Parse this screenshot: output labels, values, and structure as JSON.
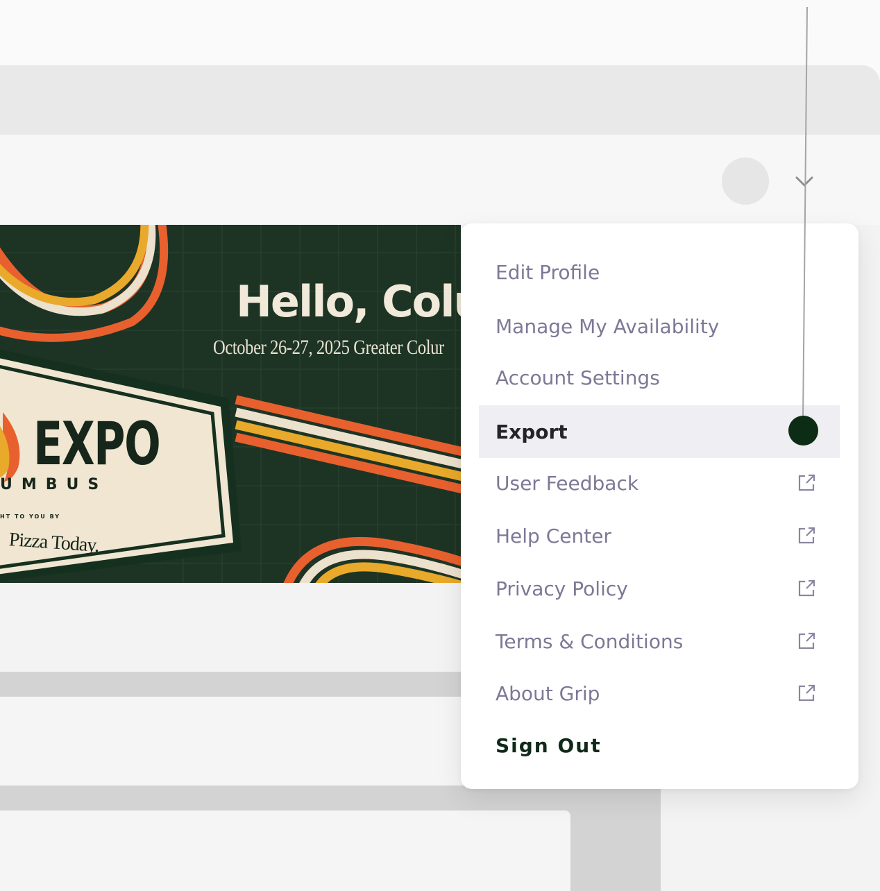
{
  "banner": {
    "headline": "Hello, Colu",
    "date_line": "October 26-27, 2025  Greater Colur",
    "logo_word": "EXPO",
    "city_fragment": "UMBUS",
    "brought_by": "HT TO YOU BY",
    "sponsor": "Pizza Today."
  },
  "menu": {
    "items": [
      {
        "label": "Edit Profile",
        "external": false
      },
      {
        "label": "Manage My Availability",
        "external": false
      },
      {
        "label": "Account Settings",
        "external": false
      },
      {
        "label": "Export",
        "external": false,
        "active": true
      },
      {
        "label": "User Feedback",
        "external": true
      },
      {
        "label": "Help Center",
        "external": true
      },
      {
        "label": "Privacy Policy",
        "external": true
      },
      {
        "label": "Terms & Conditions",
        "external": true
      },
      {
        "label": "About Grip",
        "external": true
      }
    ],
    "sign_out": "Sign Out"
  },
  "colors": {
    "menu_text": "#7d7896",
    "active_bg": "#eeeef3",
    "brand_dark_green": "#0f2a18",
    "banner_bg": "#1d3424"
  }
}
